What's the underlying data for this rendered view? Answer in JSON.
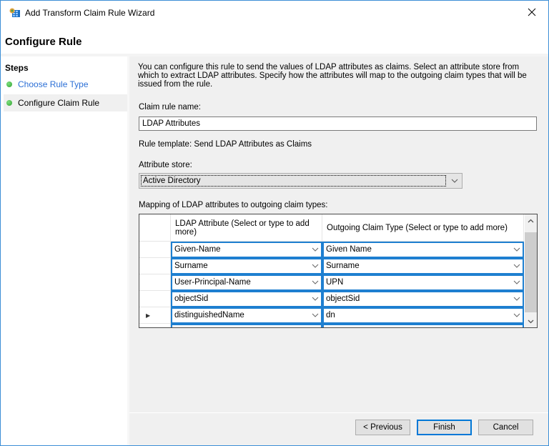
{
  "window": {
    "title": "Add Transform Claim Rule Wizard",
    "app_icon": "adfs-wizard-icon",
    "close_icon": "close-icon"
  },
  "header": {
    "title": "Configure Rule"
  },
  "sidebar": {
    "title": "Steps",
    "steps": [
      {
        "label": "Choose Rule Type",
        "state": "link",
        "icon": "green-dot-icon"
      },
      {
        "label": "Configure Claim Rule",
        "state": "current",
        "icon": "green-dot-icon"
      }
    ]
  },
  "main": {
    "description": "You can configure this rule to send the values of LDAP attributes as claims. Select an attribute store from which to extract LDAP attributes. Specify how the attributes will map to the outgoing claim types that will be issued from the rule.",
    "claim_rule_name_label": "Claim rule name:",
    "claim_rule_name_value": "LDAP Attributes",
    "rule_template": "Rule template: Send LDAP Attributes as Claims",
    "attribute_store_label": "Attribute store:",
    "attribute_store_value": "Active Directory",
    "mapping_label": "Mapping of LDAP attributes to outgoing claim types:",
    "grid": {
      "columns": [
        "LDAP Attribute (Select or type to add more)",
        "Outgoing Claim Type (Select or type to add more)"
      ],
      "rows": [
        {
          "ldap": "Given-Name",
          "claim": "Given Name",
          "current": false
        },
        {
          "ldap": "Surname",
          "claim": "Surname",
          "current": false
        },
        {
          "ldap": "User-Principal-Name",
          "claim": "UPN",
          "current": false
        },
        {
          "ldap": "objectSid",
          "claim": "objectSid",
          "current": false
        },
        {
          "ldap": "distinguishedName",
          "claim": "dn",
          "current": true
        },
        {
          "ldap": "",
          "claim": "",
          "current": false
        }
      ],
      "current_row_marker": "▶"
    }
  },
  "footer": {
    "previous_label": "< Previous",
    "finish_label": "Finish",
    "cancel_label": "Cancel"
  }
}
